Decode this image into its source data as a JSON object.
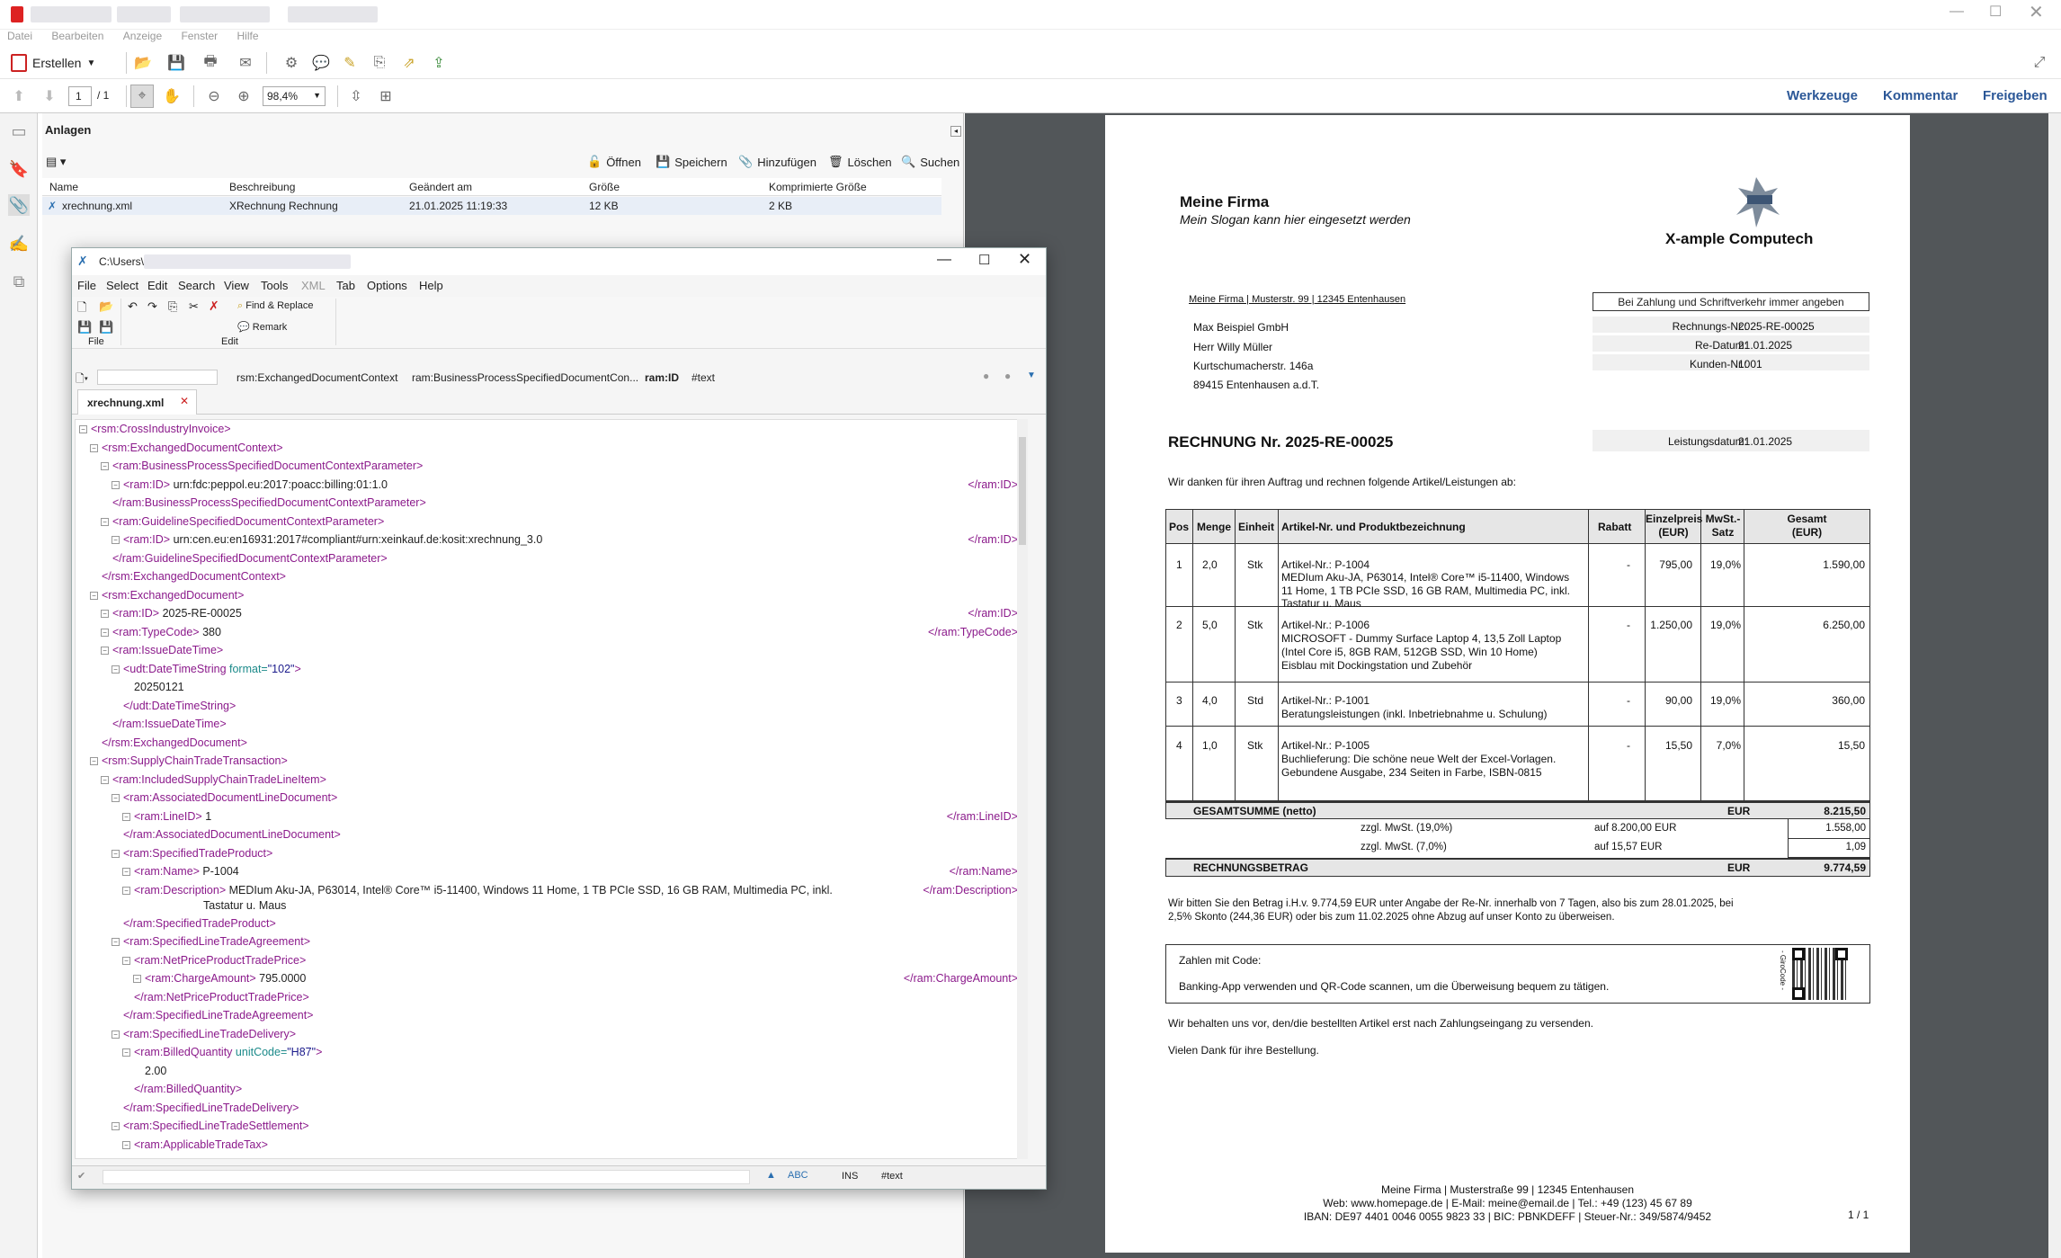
{
  "menubar": [
    "Datei",
    "Bearbeiten",
    "Anzeige",
    "Fenster",
    "Hilfe"
  ],
  "toolbar": {
    "create_label": "Erstellen"
  },
  "nav": {
    "page_current": "1",
    "page_total": "/ 1",
    "zoom": "98,4%"
  },
  "right_tabs": [
    "Werkzeuge",
    "Kommentar",
    "Freigeben"
  ],
  "attachments": {
    "title": "Anlagen",
    "actions": [
      "Öffnen",
      "Speichern",
      "Hinzufügen",
      "Löschen",
      "Suchen"
    ],
    "columns": [
      "Name",
      "Beschreibung",
      "Geändert am",
      "Größe",
      "Komprimierte Größe"
    ],
    "row": [
      "xrechnung.xml",
      "XRechnung Rechnung",
      "21.01.2025 11:19:33",
      "12 KB",
      "2 KB"
    ]
  },
  "xml_editor": {
    "title": "C:\\Users\\",
    "menu": [
      "File",
      "Select",
      "Edit",
      "Search",
      "View",
      "Tools",
      "XML",
      "Tab",
      "Options",
      "Help"
    ],
    "ribbon": {
      "find_replace": "Find & Replace",
      "remark": "Remark",
      "group_file": "File",
      "group_edit": "Edit"
    },
    "breadcrumb": [
      "rsm:ExchangedDocumentContext",
      "ram:BusinessProcessSpecifiedDocumentCon...",
      "ram:ID",
      "#text"
    ],
    "tab": "xrechnung.xml",
    "status": {
      "ins": "INS",
      "node": "#text"
    },
    "lines": [
      {
        "t": "<rsm:CrossIndustryInvoice>"
      },
      {
        "t": "<rsm:ExchangedDocumentContext>"
      },
      {
        "t": "<ram:BusinessProcessSpecifiedDocumentContextParameter>"
      },
      {
        "t": "<ram:ID>",
        "v": "urn:fdc:peppol.eu:2017:poacc:billing:01:1.0",
        "c": "</ram:ID>"
      },
      {
        "t": "</ram:BusinessProcessSpecifiedDocumentContextParameter>"
      },
      {
        "t": "<ram:GuidelineSpecifiedDocumentContextParameter>"
      },
      {
        "t": "<ram:ID>",
        "v": "urn:cen.eu:en16931:2017#compliant#urn:xeinkauf.de:kosit:xrechnung_3.0",
        "c": "</ram:ID>"
      },
      {
        "t": "</ram:GuidelineSpecifiedDocumentContextParameter>"
      },
      {
        "t": "</rsm:ExchangedDocumentContext>"
      },
      {
        "t": "<rsm:ExchangedDocument>"
      },
      {
        "t": "<ram:ID>",
        "v": "2025-RE-00025",
        "c": "</ram:ID>"
      },
      {
        "t": "<ram:TypeCode>",
        "v": "380",
        "c": "</ram:TypeCode>"
      },
      {
        "t": "<ram:IssueDateTime>"
      },
      {
        "t": "<udt:DateTimeString",
        "a": "format",
        "av": "\"102\"",
        "e": ">"
      },
      {
        "v": "20250121"
      },
      {
        "t": "</udt:DateTimeString>"
      },
      {
        "t": "</ram:IssueDateTime>"
      },
      {
        "t": "</rsm:ExchangedDocument>"
      },
      {
        "t": "<rsm:SupplyChainTradeTransaction>"
      },
      {
        "t": "<ram:IncludedSupplyChainTradeLineItem>"
      },
      {
        "t": "<ram:AssociatedDocumentLineDocument>"
      },
      {
        "t": "<ram:LineID>",
        "v": "1",
        "c": "</ram:LineID>"
      },
      {
        "t": "</ram:AssociatedDocumentLineDocument>"
      },
      {
        "t": "<ram:SpecifiedTradeProduct>"
      },
      {
        "t": "<ram:Name>",
        "v": "P-1004",
        "c": "</ram:Name>"
      },
      {
        "t": "<ram:Description>",
        "v": "MEDIum Aku-JA, P63014, Intel® Core™ i5-11400, Windows 11 Home, 1 TB PCIe SSD, 16 GB RAM, Multimedia PC, inkl.",
        "v2": "Tastatur u. Maus",
        "c": "</ram:Description>"
      },
      {
        "t": "</ram:SpecifiedTradeProduct>"
      },
      {
        "t": "<ram:SpecifiedLineTradeAgreement>"
      },
      {
        "t": "<ram:NetPriceProductTradePrice>"
      },
      {
        "t": "<ram:ChargeAmount>",
        "v": "795.0000",
        "c": "</ram:ChargeAmount>"
      },
      {
        "t": "</ram:NetPriceProductTradePrice>"
      },
      {
        "t": "</ram:SpecifiedLineTradeAgreement>"
      },
      {
        "t": "<ram:SpecifiedLineTradeDelivery>"
      },
      {
        "t": "<ram:BilledQuantity",
        "a": "unitCode",
        "av": "\"H87\"",
        "e": ">"
      },
      {
        "v": "2.00"
      },
      {
        "t": "</ram:BilledQuantity>"
      },
      {
        "t": "</ram:SpecifiedLineTradeDelivery>"
      },
      {
        "t": "<ram:SpecifiedLineTradeSettlement>"
      },
      {
        "t": "<ram:ApplicableTradeTax>"
      }
    ]
  },
  "invoice": {
    "company": "Meine Firma",
    "slogan": "Mein Slogan kann hier eingesetzt werden",
    "brand": "X-ample Computech",
    "sender_line": "Meine Firma | Musterstr. 99 | 12345 Entenhausen",
    "notice": "Bei Zahlung und Schriftverkehr immer angeben",
    "recipient": [
      "Max Beispiel GmbH",
      "Herr Willy Müller",
      "Kurtschumacherstr. 146a",
      "89415 Entenhausen a.d.T."
    ],
    "meta": [
      {
        "k": "Rechnungs-Nr.:",
        "v": "2025-RE-00025"
      },
      {
        "k": "Re-Datum:",
        "v": "21.01.2025"
      },
      {
        "k": "Kunden-Nr.:",
        "v": "1001"
      }
    ],
    "heading": "RECHNUNG Nr. 2025-RE-00025",
    "service_date_label": "Leistungsdatum:",
    "service_date": "21.01.2025",
    "intro": "Wir danken für ihren Auftrag und rechnen folgende Artikel/Leistungen ab:",
    "columns": {
      "pos": "Pos",
      "menge": "Menge",
      "einheit": "Einheit",
      "artikel": "Artikel-Nr. und Produktbezeichnung",
      "rabatt": "Rabatt",
      "ep1": "Einzelpreis",
      "ep2": "(EUR)",
      "mw1": "MwSt.-",
      "mw2": "Satz",
      "g1": "Gesamt",
      "g2": "(EUR)"
    },
    "items": [
      {
        "pos": "1",
        "menge": "2,0",
        "einheit": "Stk",
        "lines": [
          "Artikel-Nr.: P-1004",
          "MEDIum Aku-JA, P63014, Intel® Core™ i5-11400, Windows",
          "11 Home, 1 TB PCIe SSD, 16 GB RAM, Multimedia PC, inkl.",
          "Tastatur u. Maus"
        ],
        "rabatt": "-",
        "ep": "795,00",
        "mwst": "19,0%",
        "gesamt": "1.590,00"
      },
      {
        "pos": "2",
        "menge": "5,0",
        "einheit": "Stk",
        "lines": [
          "Artikel-Nr.: P-1006",
          "MICROSOFT - Dummy Surface Laptop 4, 13,5 Zoll Laptop",
          "(Intel Core i5, 8GB RAM, 512GB SSD, Win 10 Home)",
          "Eisblau mit Dockingstation und Zubehör"
        ],
        "rabatt": "-",
        "ep": "1.250,00",
        "mwst": "19,0%",
        "gesamt": "6.250,00"
      },
      {
        "pos": "3",
        "menge": "4,0",
        "einheit": "Std",
        "lines": [
          "Artikel-Nr.: P-1001",
          "Beratungsleistungen (inkl. Inbetriebnahme u. Schulung)"
        ],
        "rabatt": "-",
        "ep": "90,00",
        "mwst": "19,0%",
        "gesamt": "360,00"
      },
      {
        "pos": "4",
        "menge": "1,0",
        "einheit": "Stk",
        "lines": [
          "Artikel-Nr.: P-1005",
          "Buchlieferung: Die schöne neue Welt der Excel-Vorlagen.",
          "Gebundene Ausgabe, 234 Seiten in Farbe, ISBN-0815"
        ],
        "rabatt": "-",
        "ep": "15,50",
        "mwst": "7,0%",
        "gesamt": "15,50"
      }
    ],
    "total_label": "GESAMTSUMME  (netto)",
    "currency": "EUR",
    "total_net": "8.215,50",
    "tax": [
      {
        "l": "zzgl. MwSt. (19,0%)",
        "b": "auf 8.200,00 EUR",
        "v": "1.558,00"
      },
      {
        "l": "zzgl. MwSt. (7,0%)",
        "b": "auf 15,57 EUR",
        "v": "1,09"
      }
    ],
    "grand_label": "RECHNUNGSBETRAG",
    "grand_total": "9.774,59",
    "payment": [
      "Wir bitten Sie den Betrag i.H.v. 9.774,59 EUR unter Angabe der Re-Nr. innerhalb von 7 Tagen, also bis zum 28.01.2025, bei",
      "2,5% Skonto (244,36 EUR) oder bis zum 11.02.2025 ohne Abzug auf unser Konto zu überweisen."
    ],
    "qr_title": "Zahlen mit Code:",
    "qr_text": "Banking-App verwenden und QR-Code scannen, um die Überweisung bequem zu tätigen.",
    "qr_side": "- GiroCode -",
    "ownership": "Wir behalten uns vor, den/die bestellten Artikel erst nach Zahlungseingang zu versenden.",
    "thanks": "Vielen Dank für ihre Bestellung.",
    "footer": [
      "Meine Firma | Musterstraße 99 | 12345 Entenhausen",
      "Web: www.homepage.de | E-Mail: meine@email.de | Tel.: +49 (123) 45 67 89",
      "IBAN: DE97 4401 0046 0055 9823 33 | BIC: PBNKDEFF | Steuer-Nr.: 349/5874/9452"
    ],
    "page_num": "1 / 1"
  }
}
